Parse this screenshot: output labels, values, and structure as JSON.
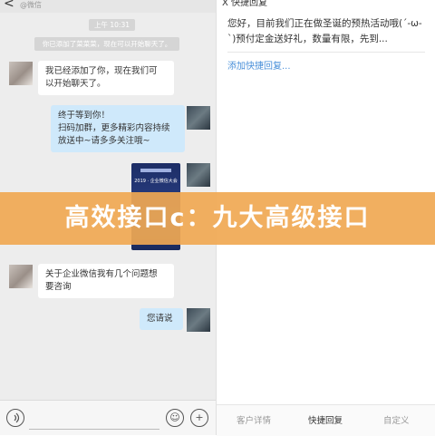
{
  "chat": {
    "back_glyph": "<",
    "header_label": "@微信",
    "time": "上午 10:31",
    "system_notice": "你已添加了菜菜菜，现在可以开始聊天了。",
    "messages": [
      {
        "side": "left",
        "text": "我已经添加了你，现在我们可\n以开始聊天了。"
      },
      {
        "side": "right",
        "text": "终于等到你！\n扫码加群，更多精彩内容持续\n放送中~请多多关注哦~"
      },
      {
        "side": "right",
        "type": "image",
        "caption": "2019 · 企业微信大会"
      },
      {
        "side": "left",
        "text": "关于企业微信我有几个问题想\n要咨询"
      },
      {
        "side": "right",
        "text": "您请说"
      }
    ]
  },
  "input": {
    "voice_icon": "voice-icon",
    "emoji_glyph": "☺",
    "plus_glyph": "+"
  },
  "quick_reply": {
    "header": "X    快捷回复",
    "reply_text": "您好，目前我们正在做圣诞的预热活动哦(´-ω-`)预付定金送好礼，数量有限，先到...",
    "add_link": "添加快捷回复..."
  },
  "tabs": [
    {
      "label": "客户详情",
      "active": false
    },
    {
      "label": "快捷回复",
      "active": true
    },
    {
      "label": "自定义",
      "active": false
    }
  ],
  "banner": {
    "text": "高效接口c：九大高级接口",
    "color": "#f0a852"
  }
}
